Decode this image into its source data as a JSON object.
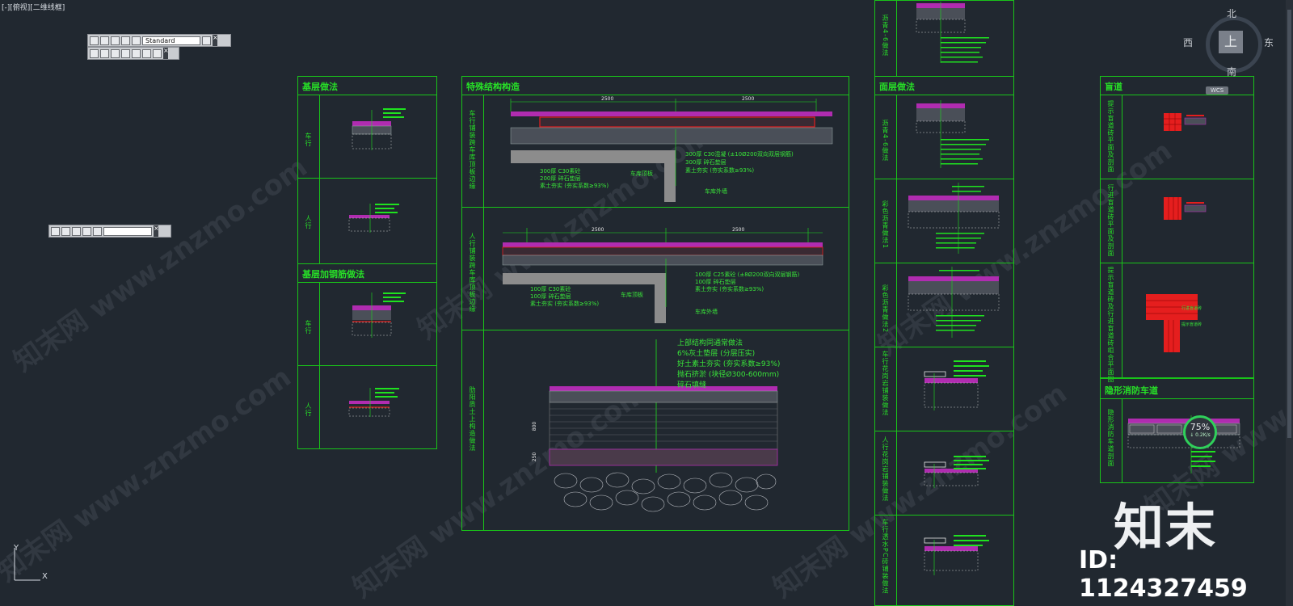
{
  "viewport": {
    "label": "[-][俯视][二维线框]"
  },
  "toolbar": {
    "style_select": "Standard"
  },
  "panels": {
    "base_title": "基层做法",
    "base_rows": [
      "车行",
      "人行"
    ],
    "rebar_title": "基层加钢筋做法",
    "rebar_rows": [
      "车行",
      "人行"
    ],
    "special_title": "特殊结构构造",
    "special_rows": [
      "车行铺装跨车库顶板边缘",
      "人行铺装跨车库顶板边缘",
      "肋阳质土上构造做法"
    ],
    "special_dims": [
      "2500",
      "2500",
      "2500",
      "2500",
      "800",
      "250"
    ],
    "special_notes_1": [
      "300厚 C30混凝 (±10Ø200双向双层钢筋)",
      "300厚 碎石垫层",
      "素土夯实 (夯实系数≥93%)"
    ],
    "special_notes_1_left": [
      "300厚 C30素砼",
      "200厚 碎石垫层",
      "素土夯实 (夯实系数≥93%)"
    ],
    "special_notes_1_tags": [
      "车库顶板",
      "车库外墙"
    ],
    "special_notes_2": [
      "100厚 C25素砼 (±8Ø200双向双层钢筋)",
      "100厚 碎石垫层",
      "素土夯实 (夯实系数≥93%)"
    ],
    "special_notes_2_left": [
      "100厚 C30素砼",
      "100厚 碎石垫层",
      "素土夯实 (夯实系数≥93%)"
    ],
    "special_notes_2_tags": [
      "车库顶板",
      "车库外墙"
    ],
    "special_notes_3": [
      "上部结构同通常做法",
      "6%灰土垫层 (分层压实)",
      "好土素土夯实 (夯实系数≥93%)",
      "抛石挤淤 (块径Ø300-600mm)",
      "碎石填缝"
    ],
    "surface_title": "面层做法",
    "surface_rows": [
      "沥青4-6做法",
      "沥青4-6做法",
      "彩色沥青做法1",
      "彩色沥青做法2",
      "车行花岗岩铺装做法",
      "人行花岗岩铺装做法",
      "车行透水PC砖铺装做法"
    ],
    "blind_title": "盲道",
    "blind_rows": [
      "提示盲道砖平面及剖面",
      "行进盲道砖平面及剖面",
      "提示盲道砖及行进盲道砖组合平面图"
    ],
    "fire_title": "隐形消防车道",
    "fire_rows": [
      "隐形消防车道剖面"
    ],
    "blind_tags": [
      "行进盲道砖",
      "提示盲道砖"
    ]
  },
  "compass": {
    "north": "北",
    "south": "南",
    "west": "西",
    "east": "东",
    "center": "上"
  },
  "wcs": "WCS",
  "progress": {
    "percent": "75%",
    "rate": "↓ 0.2K/s"
  },
  "watermark": {
    "brand": "知末",
    "id": "ID: 1124327459",
    "text": "知末网 www.znzmo.com"
  },
  "ucs": {
    "x": "X",
    "y": "Y"
  },
  "colors": {
    "background": "#212830",
    "frame": "#19c419",
    "text_green": "#27e027",
    "hatch_magenta": "#b02cb0",
    "blind_red": "#e51e1e"
  }
}
